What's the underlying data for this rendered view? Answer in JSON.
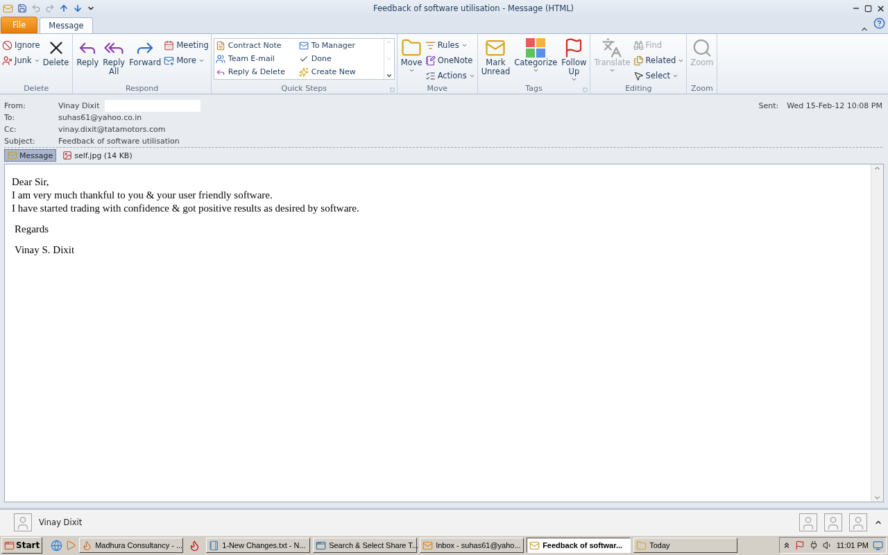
{
  "window": {
    "title": "Feedback of software utilisation  -  Message (HTML)"
  },
  "ribbon": {
    "tabs": [
      {
        "label": "File",
        "kind": "file",
        "selected": false
      },
      {
        "label": "Message",
        "kind": "tab",
        "selected": true
      }
    ],
    "groups": [
      {
        "name": "Delete",
        "launcher": false,
        "items": [
          {
            "label": "Ignore",
            "kind": "small",
            "dropdown": false,
            "disabled": false
          },
          {
            "label": "Junk",
            "kind": "small",
            "dropdown": true,
            "disabled": false
          },
          {
            "label": "Delete",
            "kind": "large",
            "dropdown": false,
            "disabled": false
          }
        ]
      },
      {
        "name": "Respond",
        "launcher": false,
        "items": [
          {
            "label": "Reply",
            "kind": "large",
            "dropdown": false,
            "disabled": false
          },
          {
            "label": "Reply All",
            "kind": "large",
            "dropdown": false,
            "disabled": false
          },
          {
            "label": "Forward",
            "kind": "large",
            "dropdown": false,
            "disabled": false
          },
          {
            "label": "Meeting",
            "kind": "small",
            "dropdown": false,
            "disabled": false
          },
          {
            "label": "More",
            "kind": "small",
            "dropdown": true,
            "disabled": false
          }
        ]
      },
      {
        "name": "Quick Steps",
        "launcher": true,
        "items": [
          {
            "label": "Contract Note",
            "kind": "gallery",
            "disabled": false
          },
          {
            "label": "Team E-mail",
            "kind": "gallery",
            "disabled": false
          },
          {
            "label": "Reply & Delete",
            "kind": "gallery",
            "disabled": false
          },
          {
            "label": "To Manager",
            "kind": "gallery",
            "disabled": false
          },
          {
            "label": "Done",
            "kind": "gallery",
            "disabled": false
          },
          {
            "label": "Create New",
            "kind": "gallery",
            "disabled": false
          }
        ]
      },
      {
        "name": "Move",
        "launcher": false,
        "items": [
          {
            "label": "Move",
            "kind": "large",
            "dropdown": true,
            "disabled": false
          },
          {
            "label": "Rules",
            "kind": "small",
            "dropdown": true,
            "disabled": false
          },
          {
            "label": "OneNote",
            "kind": "small",
            "dropdown": false,
            "disabled": false
          },
          {
            "label": "Actions",
            "kind": "small",
            "dropdown": true,
            "disabled": false
          }
        ]
      },
      {
        "name": "Tags",
        "launcher": true,
        "items": [
          {
            "label": "Mark Unread",
            "kind": "large",
            "dropdown": false,
            "disabled": false
          },
          {
            "label": "Categorize",
            "kind": "large",
            "dropdown": true,
            "disabled": false
          },
          {
            "label": "Follow Up",
            "kind": "large",
            "dropdown": true,
            "disabled": false
          }
        ]
      },
      {
        "name": "Editing",
        "launcher": false,
        "items": [
          {
            "label": "Translate",
            "kind": "large",
            "dropdown": true,
            "disabled": true
          },
          {
            "label": "Find",
            "kind": "small",
            "dropdown": false,
            "disabled": true
          },
          {
            "label": "Related",
            "kind": "small",
            "dropdown": true,
            "disabled": false
          },
          {
            "label": "Select",
            "kind": "small",
            "dropdown": true,
            "disabled": false
          }
        ]
      },
      {
        "name": "Zoom",
        "launcher": false,
        "items": [
          {
            "label": "Zoom",
            "kind": "large",
            "dropdown": false,
            "disabled": true
          }
        ]
      }
    ]
  },
  "header": {
    "fields": [
      {
        "label": "From:",
        "value": "Vinay Dixit",
        "kind": "sender"
      },
      {
        "label": "To:",
        "value": "suhas61@yahoo.co.in",
        "kind": "plain"
      },
      {
        "label": "Cc:",
        "value": "vinay.dixit@tatamotors.com",
        "kind": "plain"
      },
      {
        "label": "Subject:",
        "value": "Feedback of software utilisation",
        "kind": "plain"
      }
    ],
    "sent": {
      "label": "Sent:",
      "value": "Wed 15-Feb-12 10:08 PM"
    },
    "attachments": [
      {
        "label": "Message",
        "kind": "message",
        "selected": true
      },
      {
        "label": "self.jpg (14 KB)",
        "kind": "file",
        "selected": false
      }
    ]
  },
  "body": {
    "paragraphs": [
      {
        "text": "Dear Sir,",
        "kind": "line"
      },
      {
        "text": "I am very much thankful to you & your user friendly software.",
        "kind": "line"
      },
      {
        "text": "I have started trading with confidence & got positive results as desired by software.",
        "kind": "line"
      },
      {
        "text": "Regards",
        "kind": "block"
      },
      {
        "text": "Vinay S. Dixit",
        "kind": "block"
      }
    ]
  },
  "people_pane": {
    "name": "Vinay Dixit"
  },
  "taskbar": {
    "start": "Start",
    "tasks": [
      {
        "label": "Madhura Consultancy - ...",
        "kind": "firefox",
        "selected": false
      },
      {
        "kind": "filezilla",
        "selected": false
      },
      {
        "label": "1-New Changes.txt - N...",
        "kind": "notepad",
        "selected": false
      },
      {
        "label": "Search & Select Share T...",
        "kind": "app",
        "selected": false
      },
      {
        "label": "Inbox - suhas61@yaho...",
        "kind": "outlook",
        "selected": false
      },
      {
        "label": "Feedback of softwar...",
        "kind": "mail",
        "selected": true
      },
      {
        "label": "Today",
        "kind": "folder",
        "selected": false
      }
    ],
    "clock": "11:01 PM"
  }
}
